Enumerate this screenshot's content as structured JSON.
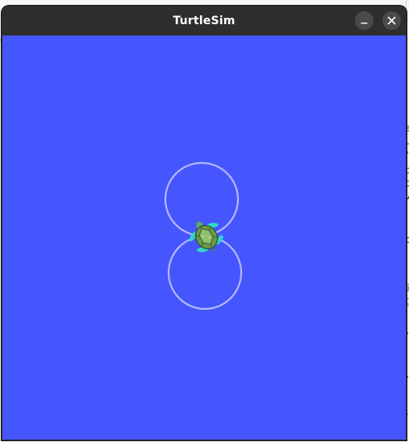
{
  "window": {
    "title": "TurtleSim"
  },
  "colors": {
    "canvas_background": "#4556ff",
    "trail": "#b3b8ff",
    "titlebar": "#2e2e2e",
    "title_text": "#ffffff"
  },
  "icons": {
    "minimize": "minimize-icon",
    "close": "close-icon",
    "turtle": "turtle-icon"
  }
}
